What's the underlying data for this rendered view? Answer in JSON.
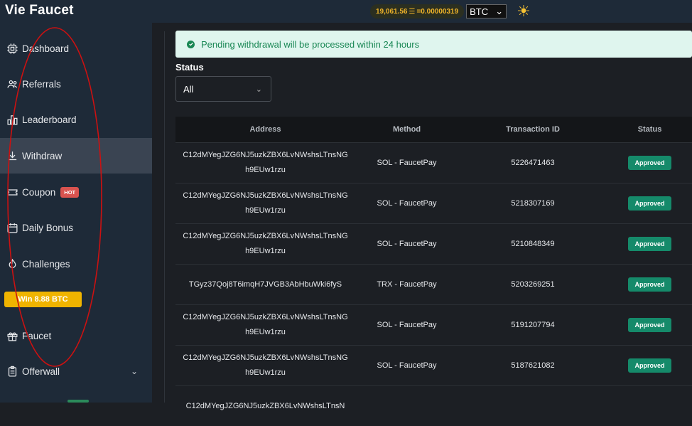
{
  "brand": "Vie Faucet",
  "ticker": {
    "price": "19,061.56",
    "rate": "=0.00000319",
    "currency": "BTC"
  },
  "sidebar": {
    "items": [
      {
        "label": "Dashboard",
        "icon": "dashboard-icon"
      },
      {
        "label": "Referrals",
        "icon": "referrals-icon"
      },
      {
        "label": "Leaderboard",
        "icon": "leaderboard-icon"
      },
      {
        "label": "Withdraw",
        "icon": "download-icon",
        "active": true
      },
      {
        "label": "Coupon",
        "icon": "coupon-icon",
        "badge": "HOT"
      },
      {
        "label": "Daily Bonus",
        "icon": "calendar-icon"
      },
      {
        "label": "Challenges",
        "icon": "challenges-icon"
      },
      {
        "label": "Faucet",
        "icon": "gift-icon"
      },
      {
        "label": "Offerwall",
        "icon": "clipboard-icon"
      }
    ],
    "win_button": "Win 8.88 BTC"
  },
  "alert": "Pending withdrawal will be processed within 24 hours",
  "filter": {
    "label": "Status",
    "selected": "All"
  },
  "table": {
    "headers": [
      "Address",
      "Method",
      "Transaction ID",
      "Status"
    ],
    "rows": [
      {
        "address": "C12dMYegJZG6NJ5uzkZBX6LvNWshsLTnsNGh9EUw1rzu",
        "method": "SOL - FaucetPay",
        "tx": "5226471463",
        "status": "Approved"
      },
      {
        "address": "C12dMYegJZG6NJ5uzkZBX6LvNWshsLTnsNGh9EUw1rzu",
        "method": "SOL - FaucetPay",
        "tx": "5218307169",
        "status": "Approved"
      },
      {
        "address": "C12dMYegJZG6NJ5uzkZBX6LvNWshsLTnsNGh9EUw1rzu",
        "method": "SOL - FaucetPay",
        "tx": "5210848349",
        "status": "Approved"
      },
      {
        "address": "TGyz37Qoj8T6imqH7JVGB3AbHbuWki6fyS",
        "method": "TRX - FaucetPay",
        "tx": "5203269251",
        "status": "Approved"
      },
      {
        "address": "C12dMYegJZG6NJ5uzkZBX6LvNWshsLTnsNGh9EUw1rzu",
        "method": "SOL - FaucetPay",
        "tx": "5191207794",
        "status": "Approved"
      },
      {
        "address": "C12dMYegJZG6NJ5uzkZBX6LvNWshsLTnsNGh9EUw1rzu",
        "method": "SOL - FaucetPay",
        "tx": "5187621082",
        "status": "Approved"
      },
      {
        "address": "C12dMYegJZG6NJ5uzkZBX6LvNWshsLTnsN",
        "method": "",
        "tx": "",
        "status": ""
      }
    ]
  },
  "colors": {
    "sidebar_bg": "#1e2a38",
    "main_bg": "#1c1f24",
    "accent_green": "#158a6a",
    "alert_bg": "#dff5ee",
    "hot_badge": "#d9534f",
    "win_button": "#f0b400",
    "annotation": "#cc1111"
  }
}
